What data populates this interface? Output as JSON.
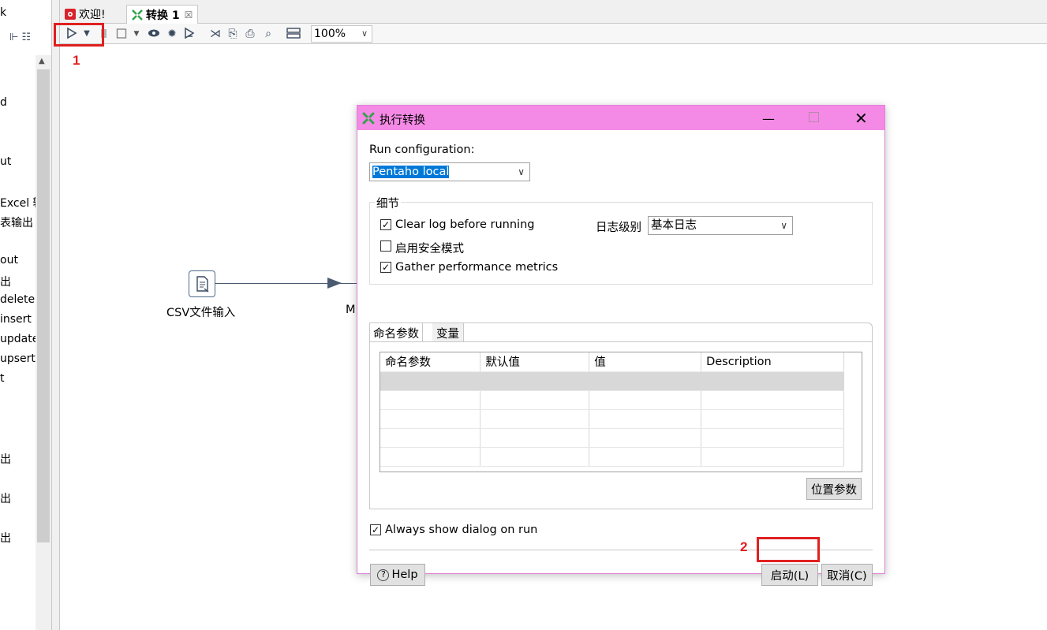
{
  "left_panel": {
    "items": [
      "k",
      "d",
      "ut",
      "Excel 输",
      "表输出",
      "out",
      "出",
      "delete",
      "insert",
      "update",
      "upsert",
      "t",
      "出",
      "出",
      "出"
    ]
  },
  "tabs": [
    {
      "label": "欢迎!",
      "icon": "pentaho-icon"
    },
    {
      "label": "转换 1",
      "icon": "transformation-icon",
      "close": "☒"
    }
  ],
  "toolbar": {
    "zoom": "100%"
  },
  "annotations": {
    "step1": "1",
    "step2": "2"
  },
  "canvas": {
    "step_csv_label": "CSV文件输入",
    "step_partial_label": "M"
  },
  "dialog": {
    "title": "执行转换",
    "run_config_label": "Run configuration:",
    "run_config_value": "Pentaho local",
    "details_group": "细节",
    "clear_log_label": "Clear log before running",
    "clear_log_checked": true,
    "safe_mode_label": "启用安全模式",
    "safe_mode_checked": false,
    "perf_metrics_label": "Gather performance metrics",
    "perf_metrics_checked": true,
    "log_level_label": "日志级别",
    "log_level_value": "基本日志",
    "tabs": [
      "命名参数",
      "变量"
    ],
    "columns": [
      "命名参数",
      "默认值",
      "值",
      "Description"
    ],
    "position_params_button": "位置参数",
    "always_show_label": "Always show dialog on run",
    "always_show_checked": true,
    "help_button": "Help",
    "launch_button": "启动(L)",
    "cancel_button": "取消(C)"
  }
}
